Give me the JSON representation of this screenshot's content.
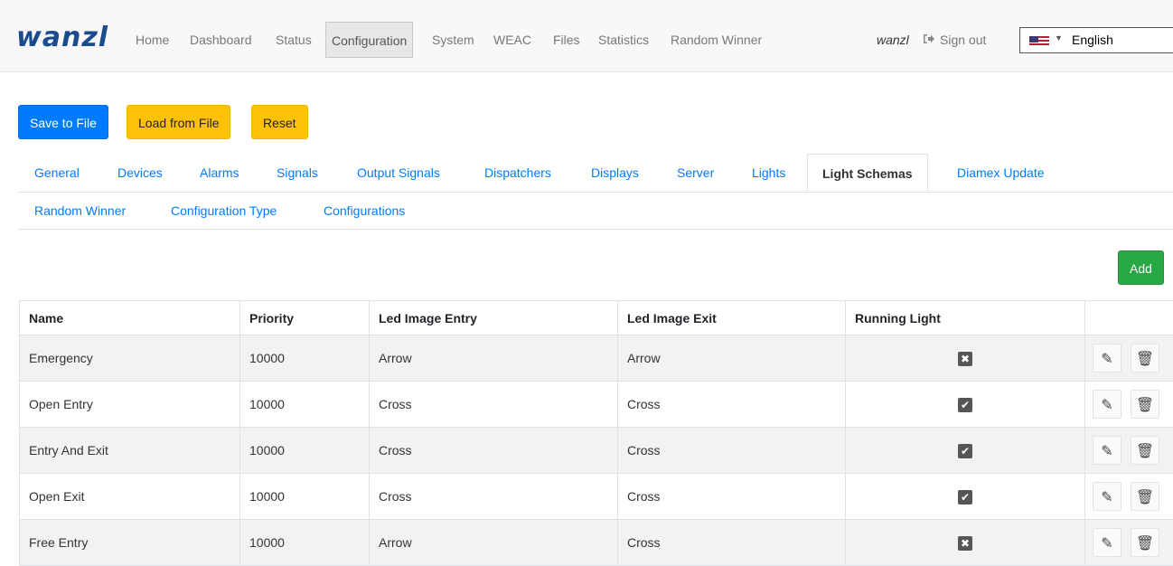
{
  "brand": "wanzl",
  "nav": {
    "items": [
      "Home",
      "Dashboard",
      "Status",
      "Configuration",
      "System",
      "WEAC",
      "Files",
      "Statistics",
      "Random Winner"
    ],
    "active": "Configuration",
    "user": "wanzl",
    "signout_label": "Sign out",
    "language": "English",
    "language_icon": "us-flag-icon"
  },
  "toolbar": {
    "save_label": "Save to File",
    "load_label": "Load from File",
    "reset_label": "Reset",
    "add_label": "Add"
  },
  "tabs": {
    "row1": [
      "General",
      "Devices",
      "Alarms",
      "Signals",
      "Output Signals",
      "Dispatchers",
      "Displays",
      "Server",
      "Lights",
      "Light Schemas",
      "Diamex Update"
    ],
    "row2": [
      "Random Winner",
      "Configuration Type",
      "Configurations"
    ],
    "active": "Light Schemas"
  },
  "table": {
    "columns": [
      "Name",
      "Priority",
      "Led Image Entry",
      "Led Image Exit",
      "Running Light",
      ""
    ],
    "rows": [
      {
        "name": "Emergency",
        "priority": "10000",
        "entry": "Arrow",
        "exit": "Arrow",
        "running_light": false
      },
      {
        "name": "Open Entry",
        "priority": "10000",
        "entry": "Cross",
        "exit": "Cross",
        "running_light": true
      },
      {
        "name": "Entry And Exit",
        "priority": "10000",
        "entry": "Cross",
        "exit": "Cross",
        "running_light": true
      },
      {
        "name": "Open Exit",
        "priority": "10000",
        "entry": "Cross",
        "exit": "Cross",
        "running_light": true
      },
      {
        "name": "Free Entry",
        "priority": "10000",
        "entry": "Arrow",
        "exit": "Cross",
        "running_light": false
      }
    ]
  },
  "colors": {
    "primary": "#007bff",
    "warning": "#ffc107",
    "success": "#28a745",
    "brand": "#1a4c8b"
  }
}
